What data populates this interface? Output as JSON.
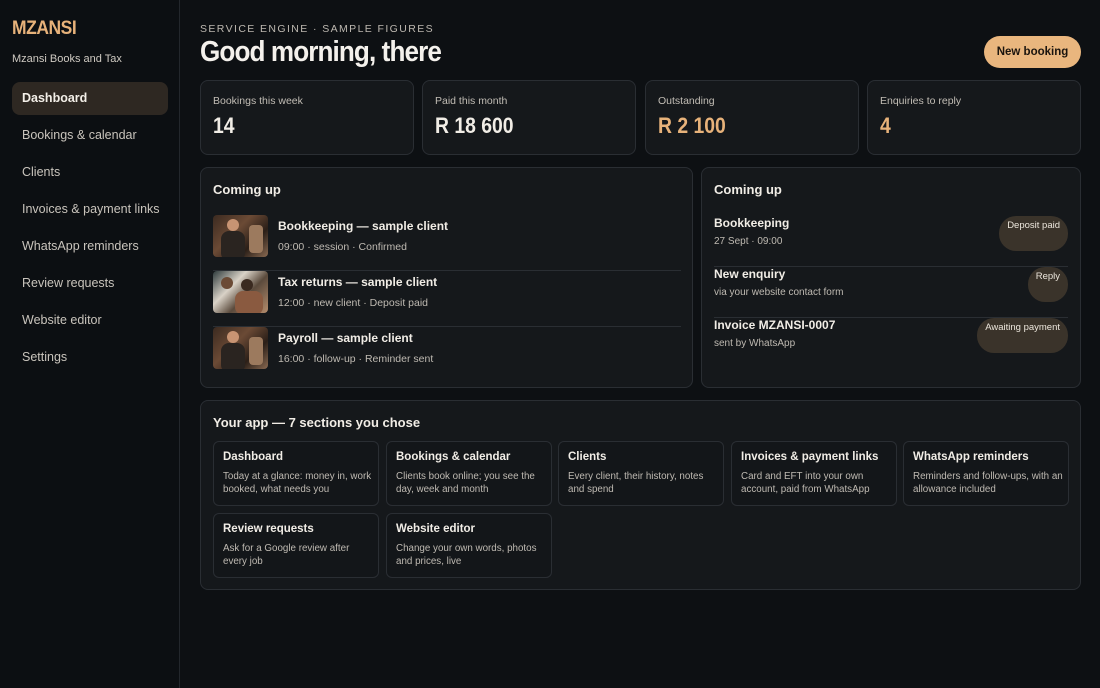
{
  "brand": {
    "name": "MZANSI",
    "subtitle": "Mzansi Books and Tax"
  },
  "nav": [
    {
      "label": "Dashboard",
      "active": true
    },
    {
      "label": "Bookings & calendar"
    },
    {
      "label": "Clients"
    },
    {
      "label": "Invoices & payment links"
    },
    {
      "label": "WhatsApp reminders"
    },
    {
      "label": "Review requests"
    },
    {
      "label": "Website editor"
    },
    {
      "label": "Settings"
    }
  ],
  "header": {
    "eyebrow": "SERVICE ENGINE · SAMPLE FIGURES",
    "greeting": "Good morning, there",
    "cta": "New booking"
  },
  "stats": [
    {
      "label": "Bookings this week",
      "value": "14"
    },
    {
      "label": "Paid this month",
      "value": "R 18 600"
    },
    {
      "label": "Outstanding",
      "value": "R 2 100"
    },
    {
      "label": "Enquiries to reply",
      "value": "4"
    }
  ],
  "appointments": {
    "title": "Coming up",
    "items": [
      {
        "title": "Bookkeeping — sample client",
        "meta": "09:00 · session · Confirmed"
      },
      {
        "title": "Tax returns — sample client",
        "meta": "12:00 · new client · Deposit paid"
      },
      {
        "title": "Payroll — sample client",
        "meta": "16:00 · follow-up · Reminder sent"
      }
    ]
  },
  "tasks": {
    "title": "Coming up",
    "items": [
      {
        "title": "Bookkeeping",
        "meta": "27 Sept · 09:00",
        "badge": "Deposit paid"
      },
      {
        "title": "New enquiry",
        "meta": "via your website contact form",
        "badge": "Reply"
      },
      {
        "title": "Invoice MZANSI-0007",
        "meta": "sent by WhatsApp",
        "badge": "Awaiting payment"
      }
    ]
  },
  "modules": {
    "title": "Your app — 7 sections you chose",
    "items": [
      {
        "title": "Dashboard",
        "desc": "Today at a glance: money in, work booked, what needs you"
      },
      {
        "title": "Bookings & calendar",
        "desc": "Clients book online; you see the day, week and month"
      },
      {
        "title": "Clients",
        "desc": "Every client, their history, notes and spend"
      },
      {
        "title": "Invoices & payment links",
        "desc": "Card and EFT into your own account, paid from WhatsApp"
      },
      {
        "title": "WhatsApp reminders",
        "desc": "Reminders and follow-ups, with an allowance included"
      },
      {
        "title": "Review requests",
        "desc": "Ask for a Google review after every job"
      },
      {
        "title": "Website editor",
        "desc": "Change your own words, photos and prices, live"
      }
    ]
  },
  "colors": {
    "accent": "#e9b67e",
    "background": "#0d1013",
    "card": "#15181b"
  }
}
